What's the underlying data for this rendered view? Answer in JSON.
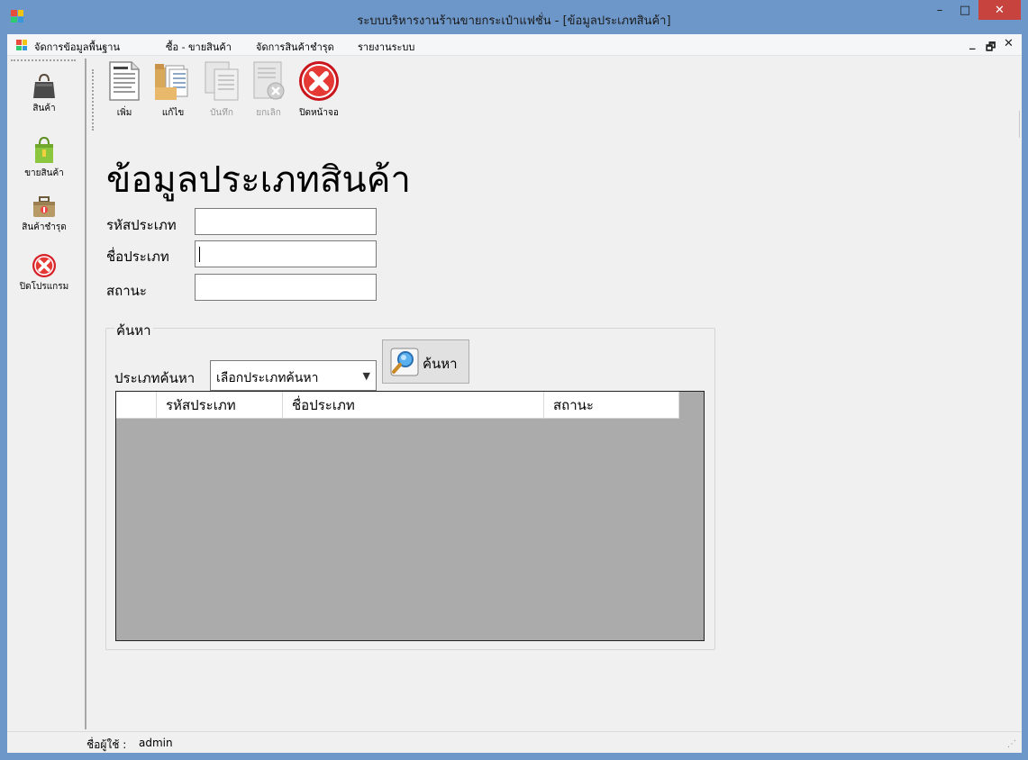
{
  "window": {
    "title": "ระบบบริหารงานร้านขายกระเป๋าแฟชั่น - [ข้อมูลประเภทสินค้า]",
    "controls": {
      "minimize": "–",
      "maximize": "□",
      "close": "✕"
    },
    "colors": {
      "titlebar": "#6e97c9",
      "close": "#c7433e"
    }
  },
  "menubar": {
    "items": [
      {
        "label": "จัดการข้อมูลพื้นฐาน"
      },
      {
        "label": "ซื้อ - ขายสินค้า"
      },
      {
        "label": "จัดการสินค้าชำรุด"
      },
      {
        "label": "รายงานระบบ"
      }
    ],
    "mdi_controls": {
      "minimize": "_",
      "restore": "🗗",
      "close": "✕"
    }
  },
  "sidebar": {
    "items": [
      {
        "label": "สินค้า",
        "icon": "handbag-icon"
      },
      {
        "label": "ขายสินค้า",
        "icon": "shopping-bag-icon"
      },
      {
        "label": "สินค้าชำรุด",
        "icon": "damaged-case-icon"
      },
      {
        "label": "ปิดโปรแกรม",
        "icon": "close-circle-icon"
      }
    ]
  },
  "toolbar": {
    "buttons": [
      {
        "label": "เพิ่ม",
        "icon": "document-icon",
        "enabled": true
      },
      {
        "label": "แก้ไข",
        "icon": "folder-files-icon",
        "enabled": true
      },
      {
        "label": "บันทึก",
        "icon": "copy-docs-icon",
        "enabled": false
      },
      {
        "label": "ยกเลิก",
        "icon": "doc-cancel-icon",
        "enabled": false
      },
      {
        "label": "ปิดหน้าจอ",
        "icon": "close-circle-icon",
        "enabled": true
      }
    ]
  },
  "form": {
    "heading": "ข้อมูลประเภทสินค้า",
    "fields": [
      {
        "label": "รหัสประเภท",
        "value": ""
      },
      {
        "label": "ชื่อประเภท",
        "value": ""
      },
      {
        "label": "สถานะ",
        "value": ""
      }
    ]
  },
  "search": {
    "group_label": "ค้นหา",
    "type_label": "ประเภทค้นหา",
    "combo_value": "เลือกประเภทค้นหา",
    "button_label": "ค้นหา"
  },
  "grid": {
    "columns": [
      "รหัสประเภท",
      "ชื่อประเภท",
      "สถานะ"
    ],
    "rows": []
  },
  "status": {
    "label": "ชื่อผู้ใช้ :",
    "user": "admin"
  }
}
